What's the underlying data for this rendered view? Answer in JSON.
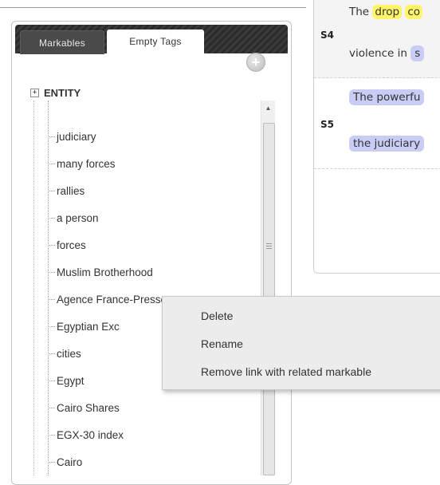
{
  "tabs": [
    {
      "label": "Markables",
      "active": false
    },
    {
      "label": "Empty Tags",
      "active": true
    }
  ],
  "add_icon": "plus-circle-icon",
  "tree": {
    "root_label": "ENTITY",
    "expander": "⊞",
    "items": [
      "judiciary",
      "many forces",
      "rallies",
      "a person",
      "forces",
      "Muslim Brotherhood",
      "Agence France-Presse",
      "Egyptian Exc",
      "cities",
      "Egypt",
      "Cairo Shares",
      "EGX-30 index",
      "Cairo"
    ]
  },
  "document": {
    "sentences": [
      {
        "id": "S4",
        "line1_prefix": "The ",
        "line1_highlight": "drop",
        "line1_highlight2": "co",
        "line2_prefix": "violence in ",
        "line2_highlight": "s"
      },
      {
        "id": "S5",
        "line1_highlight": "The powerfu",
        "line2_highlight": "the judiciary"
      }
    ]
  },
  "context_menu": {
    "items": [
      "Delete",
      "Rename",
      "Remove link with related markable"
    ]
  },
  "colors": {
    "tab_bar": "#333333",
    "highlight_yellow": "#fff46a",
    "highlight_blue": "#c9cdf5",
    "menu_bg": "#ececec"
  }
}
